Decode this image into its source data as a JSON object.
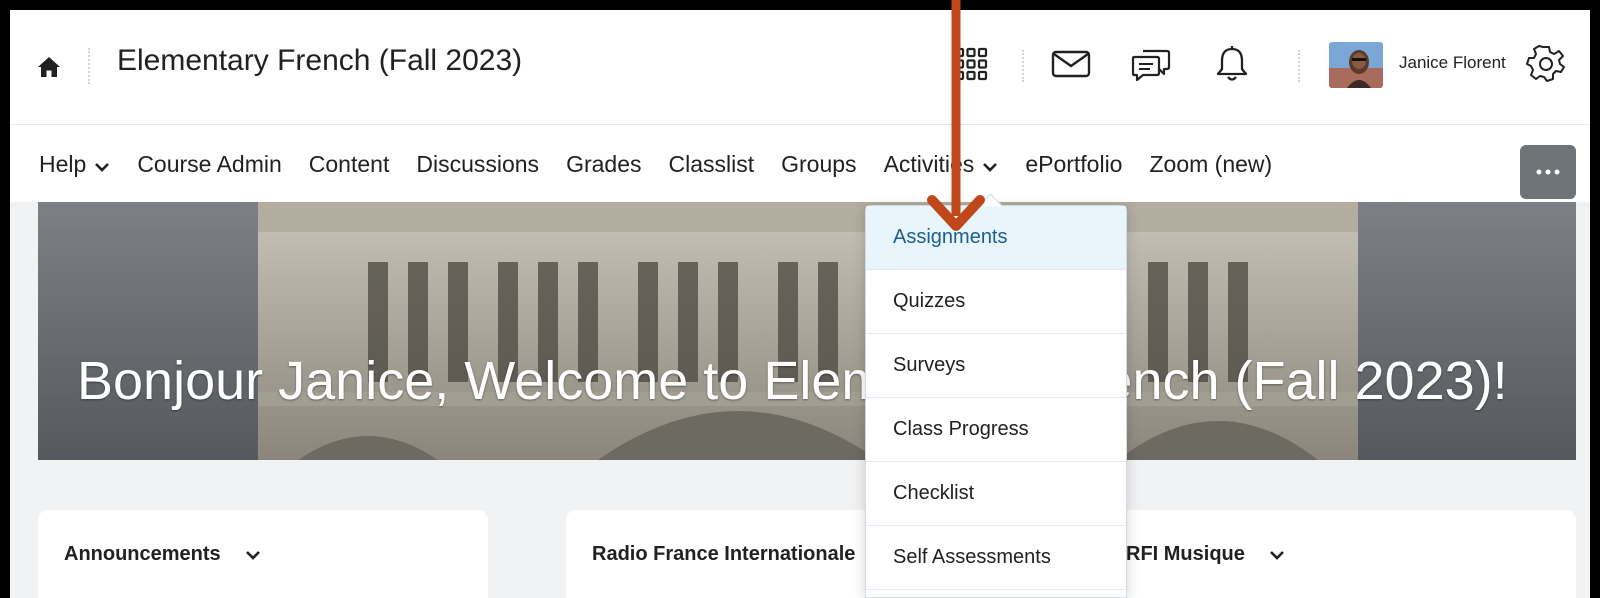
{
  "header": {
    "course_title": "Elementary French (Fall 2023)",
    "user_name": "Janice Florent"
  },
  "nav": {
    "items": [
      {
        "label": "Help",
        "has_dropdown": true
      },
      {
        "label": "Course Admin",
        "has_dropdown": false
      },
      {
        "label": "Content",
        "has_dropdown": false
      },
      {
        "label": "Discussions",
        "has_dropdown": false
      },
      {
        "label": "Grades",
        "has_dropdown": false
      },
      {
        "label": "Classlist",
        "has_dropdown": false
      },
      {
        "label": "Groups",
        "has_dropdown": false
      },
      {
        "label": "Activities",
        "has_dropdown": true
      },
      {
        "label": "ePortfolio",
        "has_dropdown": false
      },
      {
        "label": "Zoom (new)",
        "has_dropdown": false
      }
    ],
    "more_label": "…"
  },
  "banner": {
    "text": "Bonjour Janice, Welcome to Elementary French (Fall 2023)!"
  },
  "dropdown": {
    "items": [
      "Assignments",
      "Quizzes",
      "Surveys",
      "Class Progress",
      "Checklist",
      "Self Assessments"
    ],
    "active_index": 0
  },
  "widgets": [
    {
      "title": "Announcements"
    },
    {
      "title": "Radio France Internationale"
    },
    {
      "title": "RFI Musique"
    }
  ],
  "colors": {
    "annotation_arrow": "#c0471a",
    "active_item_bg": "#e8f6fc",
    "active_item_text": "#1c5e8c",
    "more_button_bg": "#6e7477"
  }
}
